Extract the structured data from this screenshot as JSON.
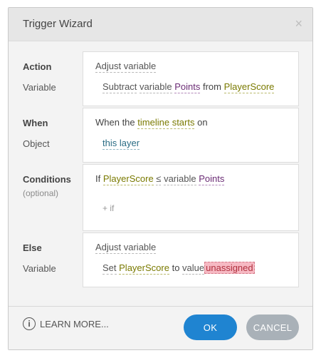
{
  "dialog": {
    "title": "Trigger Wizard",
    "close_symbol": "×"
  },
  "sections": {
    "action": {
      "label": "Action",
      "sub_label": "Variable",
      "value": "Adjust variable",
      "detail": {
        "op": "Subtract",
        "word1": "variable",
        "var": "Points",
        "word2": "from",
        "target": "PlayerScore"
      }
    },
    "when": {
      "label": "When",
      "sub_label": "Object",
      "prefix": "When the",
      "event": "timeline starts",
      "suffix": "on",
      "object": "this layer"
    },
    "conditions": {
      "label": "Conditions",
      "optional": "(optional)",
      "prefix": "If",
      "left": "PlayerScore",
      "operator": "≤",
      "word": "variable",
      "right": "Points",
      "add_if": "+ if"
    },
    "else": {
      "label": "Else",
      "sub_label": "Variable",
      "value": "Adjust variable",
      "detail": {
        "op": "Set",
        "target": "PlayerScore",
        "word1": "to",
        "word2": "value",
        "value": "unassigned"
      }
    }
  },
  "footer": {
    "learn_more": "LEARN MORE...",
    "info_icon": "i",
    "ok": "OK",
    "cancel": "CANCEL"
  }
}
